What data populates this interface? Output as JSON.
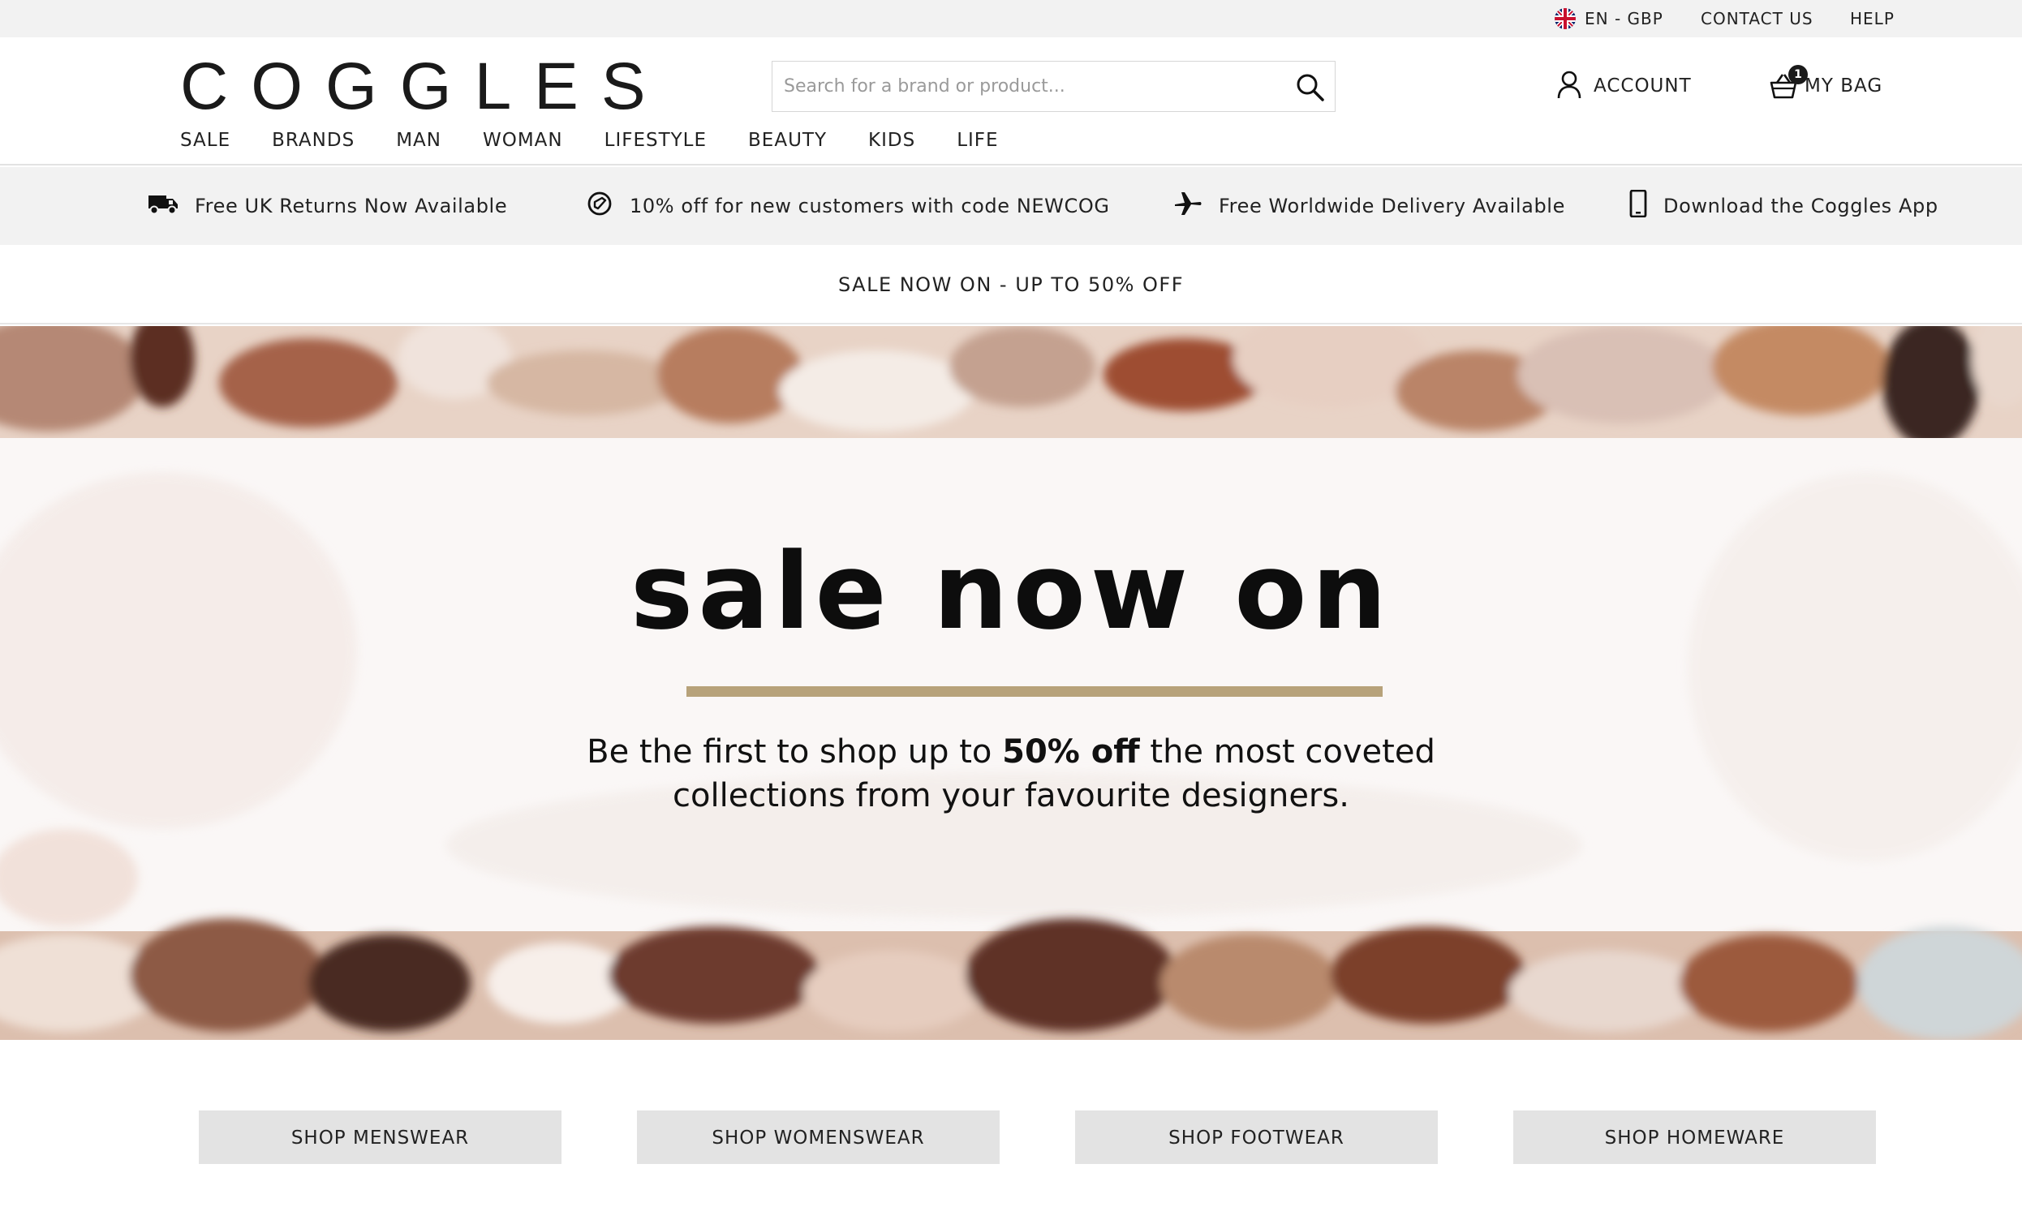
{
  "utility_bar": {
    "language": "EN - GBP",
    "contact": "CONTACT US",
    "help": "HELP"
  },
  "header": {
    "logo": "COGGLES",
    "search_placeholder": "Search for a brand or product...",
    "account_label": "ACCOUNT",
    "bag_label": "MY BAG",
    "bag_count": "1"
  },
  "nav": {
    "items": [
      "SALE",
      "BRANDS",
      "MAN",
      "WOMAN",
      "LIFESTYLE",
      "BEAUTY",
      "KIDS",
      "LIFE"
    ]
  },
  "usp_bar": {
    "items": [
      {
        "icon": "delivery-truck-icon",
        "text": "Free UK Returns Now Available"
      },
      {
        "icon": "discount-tag-icon",
        "text": "10% off for new customers with code NEWCOG"
      },
      {
        "icon": "airplane-icon",
        "text": "Free Worldwide Delivery Available"
      },
      {
        "icon": "mobile-phone-icon",
        "text": "Download the Coggles App"
      }
    ]
  },
  "sale_strip": "SALE NOW ON - UP TO 50% OFF",
  "hero": {
    "title": "sale now on",
    "subtitle_pre": "Be the first to shop up to ",
    "subtitle_bold": "50% off",
    "subtitle_post": " the most coveted",
    "subtitle_line2": "collections from your favourite designers.",
    "rule_color": "#b7a27a"
  },
  "categories": [
    "SHOP MENSWEAR",
    "SHOP WOMENSWEAR",
    "SHOP FOOTWEAR",
    "SHOP HOMEWARE"
  ],
  "colors": {
    "utility_bg": "#f2f2f2",
    "button_bg": "#e3e3e3",
    "text": "#222222"
  }
}
